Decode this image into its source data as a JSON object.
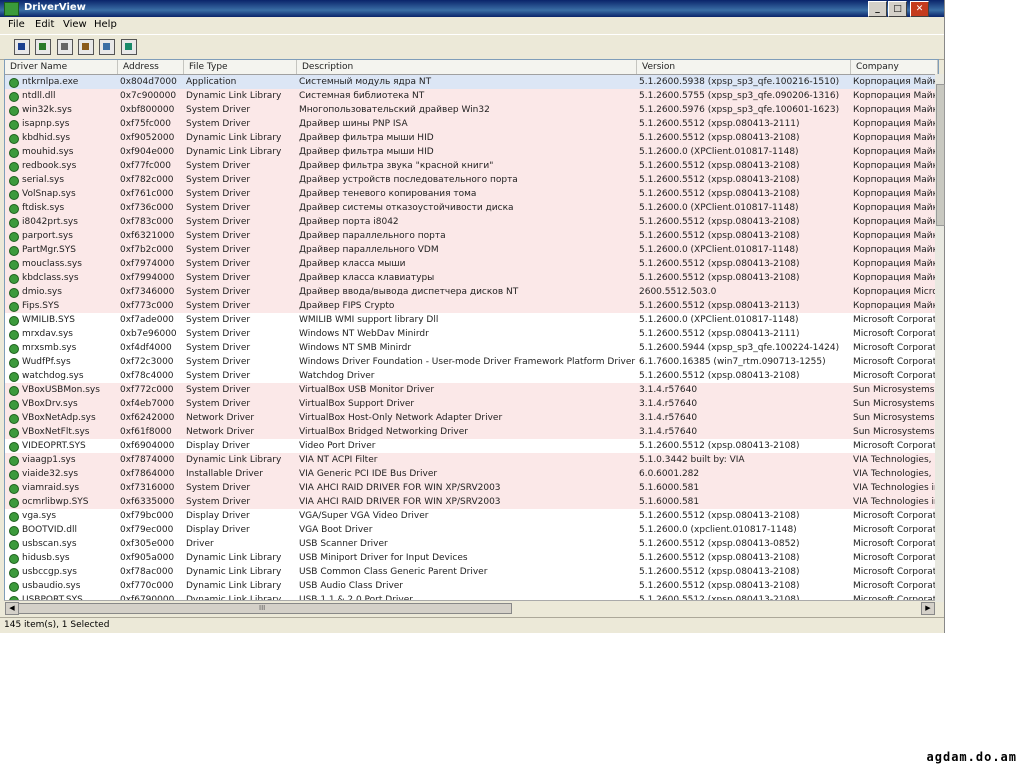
{
  "window": {
    "title": "DriverView"
  },
  "menu": [
    "File",
    "Edit",
    "View",
    "Help"
  ],
  "toolbar": [
    {
      "name": "save-icon"
    },
    {
      "name": "html-report-icon"
    },
    {
      "name": "copy-icon"
    },
    {
      "name": "properties-icon"
    },
    {
      "name": "find-icon"
    },
    {
      "name": "exit-icon"
    }
  ],
  "columns": [
    "Driver Name",
    "Address",
    "File Type",
    "Description",
    "Version",
    "Company"
  ],
  "rows": [
    {
      "name": "ntkrnlpa.exe",
      "address": "0x804d7000",
      "type": "Application",
      "desc": "Системный модуль ядра NT",
      "version": "5.1.2600.5938 (xpsp_sp3_qfe.100216-1510)",
      "company": "Корпорация Майк",
      "hl": false,
      "sel": true
    },
    {
      "name": "ntdll.dll",
      "address": "0x7c900000",
      "type": "Dynamic Link Library",
      "desc": "Системная библиотека NT",
      "version": "5.1.2600.5755 (xpsp_sp3_qfe.090206-1316)",
      "company": "Корпорация Майк",
      "hl": true
    },
    {
      "name": "win32k.sys",
      "address": "0xbf800000",
      "type": "System Driver",
      "desc": "Многопользовательский драйвер Win32",
      "version": "5.1.2600.5976 (xpsp_sp3_qfe.100601-1623)",
      "company": "Корпорация Майк",
      "hl": true
    },
    {
      "name": "isapnp.sys",
      "address": "0xf75fc000",
      "type": "System Driver",
      "desc": "Драйвер шины PNP ISA",
      "version": "5.1.2600.5512 (xpsp.080413-2111)",
      "company": "Корпорация Майк",
      "hl": true
    },
    {
      "name": "kbdhid.sys",
      "address": "0xf9052000",
      "type": "Dynamic Link Library",
      "desc": "Драйвер фильтра мыши HID",
      "version": "5.1.2600.5512 (xpsp.080413-2108)",
      "company": "Корпорация Майк",
      "hl": true
    },
    {
      "name": "mouhid.sys",
      "address": "0xf904e000",
      "type": "Dynamic Link Library",
      "desc": "Драйвер фильтра мыши HID",
      "version": "5.1.2600.0 (XPClient.010817-1148)",
      "company": "Корпорация Майк",
      "hl": true
    },
    {
      "name": "redbook.sys",
      "address": "0xf77fc000",
      "type": "System Driver",
      "desc": "Драйвер фильтра звука \"красной книги\"",
      "version": "5.1.2600.5512 (xpsp.080413-2108)",
      "company": "Корпорация Майк",
      "hl": true
    },
    {
      "name": "serial.sys",
      "address": "0xf782c000",
      "type": "System Driver",
      "desc": "Драйвер устройств последовательного порта",
      "version": "5.1.2600.5512 (xpsp.080413-2108)",
      "company": "Корпорация Майк",
      "hl": true
    },
    {
      "name": "VolSnap.sys",
      "address": "0xf761c000",
      "type": "System Driver",
      "desc": "Драйвер теневого копирования тома",
      "version": "5.1.2600.5512 (xpsp.080413-2108)",
      "company": "Корпорация Майк",
      "hl": true
    },
    {
      "name": "ftdisk.sys",
      "address": "0xf736c000",
      "type": "System Driver",
      "desc": "Драйвер системы отказоустойчивости диска",
      "version": "5.1.2600.0 (XPClient.010817-1148)",
      "company": "Корпорация Майк",
      "hl": true
    },
    {
      "name": "i8042prt.sys",
      "address": "0xf783c000",
      "type": "System Driver",
      "desc": "Драйвер порта i8042",
      "version": "5.1.2600.5512 (xpsp.080413-2108)",
      "company": "Корпорация Майк",
      "hl": true
    },
    {
      "name": "parport.sys",
      "address": "0xf6321000",
      "type": "System Driver",
      "desc": "Драйвер параллельного порта",
      "version": "5.1.2600.5512 (xpsp.080413-2108)",
      "company": "Корпорация Майк",
      "hl": true
    },
    {
      "name": "PartMgr.SYS",
      "address": "0xf7b2c000",
      "type": "System Driver",
      "desc": "Драйвер параллельного VDM",
      "version": "5.1.2600.0 (XPClient.010817-1148)",
      "company": "Корпорация Майк",
      "hl": true
    },
    {
      "name": "mouclass.sys",
      "address": "0xf7974000",
      "type": "System Driver",
      "desc": "Драйвер класса мыши",
      "version": "5.1.2600.5512 (xpsp.080413-2108)",
      "company": "Корпорация Майк",
      "hl": true
    },
    {
      "name": "kbdclass.sys",
      "address": "0xf7994000",
      "type": "System Driver",
      "desc": "Драйвер класса клавиатуры",
      "version": "5.1.2600.5512 (xpsp.080413-2108)",
      "company": "Корпорация Майк",
      "hl": true
    },
    {
      "name": "dmio.sys",
      "address": "0xf7346000",
      "type": "System Driver",
      "desc": "Драйвер ввода/вывода диспетчера дисков NT",
      "version": "2600.5512.503.0",
      "company": "Корпорация Micro",
      "hl": true
    },
    {
      "name": "Fips.SYS",
      "address": "0xf773c000",
      "type": "System Driver",
      "desc": "Драйвер FIPS Crypto",
      "version": "5.1.2600.5512 (xpsp.080413-2113)",
      "company": "Корпорация Майк",
      "hl": true
    },
    {
      "name": "WMILIB.SYS",
      "address": "0xf7ade000",
      "type": "System Driver",
      "desc": "WMILIB WMI support library Dll",
      "version": "5.1.2600.0 (XPClient.010817-1148)",
      "company": "Microsoft Corporat",
      "hl": false
    },
    {
      "name": "mrxdav.sys",
      "address": "0xb7e96000",
      "type": "System Driver",
      "desc": "Windows NT WebDav Minirdr",
      "version": "5.1.2600.5512 (xpsp.080413-2111)",
      "company": "Microsoft Corporat",
      "hl": false
    },
    {
      "name": "mrxsmb.sys",
      "address": "0xf4df4000",
      "type": "System Driver",
      "desc": "Windows NT SMB Minirdr",
      "version": "5.1.2600.5944 (xpsp_sp3_qfe.100224-1424)",
      "company": "Microsoft Corporat",
      "hl": false
    },
    {
      "name": "WudfPf.sys",
      "address": "0xf72c3000",
      "type": "System Driver",
      "desc": "Windows Driver Foundation - User-mode Driver Framework Platform Driver",
      "version": "6.1.7600.16385 (win7_rtm.090713-1255)",
      "company": "Microsoft Corporat",
      "hl": false
    },
    {
      "name": "watchdog.sys",
      "address": "0xf78c4000",
      "type": "System Driver",
      "desc": "Watchdog Driver",
      "version": "5.1.2600.5512 (xpsp.080413-2108)",
      "company": "Microsoft Corporat",
      "hl": false
    },
    {
      "name": "VBoxUSBMon.sys",
      "address": "0xf772c000",
      "type": "System Driver",
      "desc": "VirtualBox USB Monitor Driver",
      "version": "3.1.4.r57640",
      "company": "Sun Microsystems,",
      "hl": true
    },
    {
      "name": "VBoxDrv.sys",
      "address": "0xf4eb7000",
      "type": "System Driver",
      "desc": "VirtualBox Support Driver",
      "version": "3.1.4.r57640",
      "company": "Sun Microsystems,",
      "hl": true
    },
    {
      "name": "VBoxNetAdp.sys",
      "address": "0xf6242000",
      "type": "Network Driver",
      "desc": "VirtualBox Host-Only Network Adapter Driver",
      "version": "3.1.4.r57640",
      "company": "Sun Microsystems,",
      "hl": true
    },
    {
      "name": "VBoxNetFlt.sys",
      "address": "0xf61f8000",
      "type": "Network Driver",
      "desc": "VirtualBox Bridged Networking Driver",
      "version": "3.1.4.r57640",
      "company": "Sun Microsystems,",
      "hl": true
    },
    {
      "name": "VIDEOPRT.SYS",
      "address": "0xf6904000",
      "type": "Display Driver",
      "desc": "Video Port Driver",
      "version": "5.1.2600.5512 (xpsp.080413-2108)",
      "company": "Microsoft Corporat",
      "hl": false
    },
    {
      "name": "viaagp1.sys",
      "address": "0xf7874000",
      "type": "Dynamic Link Library",
      "desc": "VIA NT ACPI Filter",
      "version": "5.1.0.3442 built by: VIA",
      "company": "VIA Technologies, I",
      "hl": true
    },
    {
      "name": "viaide32.sys",
      "address": "0xf7864000",
      "type": "Installable Driver",
      "desc": "VIA Generic PCI IDE Bus Driver",
      "version": "6.0.6001.282",
      "company": "VIA Technologies, I",
      "hl": true
    },
    {
      "name": "viamraid.sys",
      "address": "0xf7316000",
      "type": "System Driver",
      "desc": "VIA AHCI RAID DRIVER FOR WIN XP/SRV2003",
      "version": "5.1.6000.581",
      "company": "VIA Technologies in",
      "hl": true
    },
    {
      "name": "ocmrlibwp.SYS",
      "address": "0xf6335000",
      "type": "System Driver",
      "desc": "VIA AHCI RAID DRIVER FOR WIN XP/SRV2003",
      "version": "5.1.6000.581",
      "company": "VIA Technologies in",
      "hl": true
    },
    {
      "name": "vga.sys",
      "address": "0xf79bc000",
      "type": "Display Driver",
      "desc": "VGA/Super VGA Video Driver",
      "version": "5.1.2600.5512 (xpsp.080413-2108)",
      "company": "Microsoft Corporat",
      "hl": false
    },
    {
      "name": "BOOTVID.dll",
      "address": "0xf79ec000",
      "type": "Display Driver",
      "desc": "VGA Boot Driver",
      "version": "5.1.2600.0 (xpclient.010817-1148)",
      "company": "Microsoft Corporat",
      "hl": false
    },
    {
      "name": "usbscan.sys",
      "address": "0xf305e000",
      "type": "Driver",
      "desc": "USB Scanner Driver",
      "version": "5.1.2600.5512 (xpsp.080413-0852)",
      "company": "Microsoft Corporat",
      "hl": false
    },
    {
      "name": "hidusb.sys",
      "address": "0xf905a000",
      "type": "Dynamic Link Library",
      "desc": "USB Miniport Driver for Input Devices",
      "version": "5.1.2600.5512 (xpsp.080413-2108)",
      "company": "Microsoft Corporat",
      "hl": false
    },
    {
      "name": "usbccgp.sys",
      "address": "0xf78ac000",
      "type": "Dynamic Link Library",
      "desc": "USB Common Class Generic Parent Driver",
      "version": "5.1.2600.5512 (xpsp.080413-2108)",
      "company": "Microsoft Corporat",
      "hl": false
    },
    {
      "name": "usbaudio.sys",
      "address": "0xf770c000",
      "type": "Dynamic Link Library",
      "desc": "USB Audio Class Driver",
      "version": "5.1.2600.5512 (xpsp.080413-2108)",
      "company": "Microsoft Corporat",
      "hl": false
    },
    {
      "name": "USBPORT.SYS",
      "address": "0xf6790000",
      "type": "Dynamic Link Library",
      "desc": "USB 1.1 & 2.0 Port Driver",
      "version": "5.1.2600.5512 (xpsp.080413-2108)",
      "company": "Microsoft Corporat",
      "hl": false
    }
  ],
  "status": "145 item(s), 1 Selected",
  "watermark": "agdam.do.am"
}
